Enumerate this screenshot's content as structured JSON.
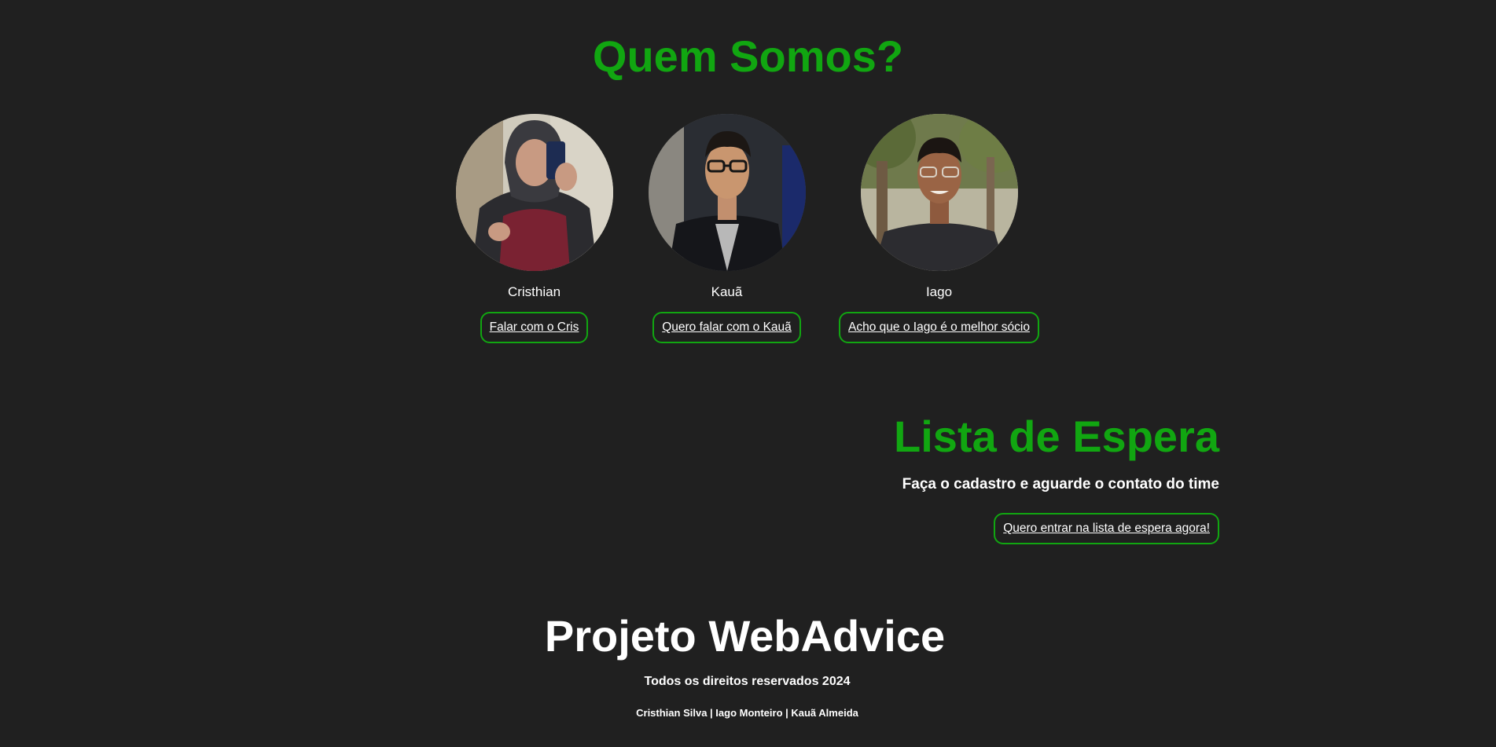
{
  "about": {
    "title": "Quem Somos?",
    "members": [
      {
        "name": "Cristhian",
        "link_label": "Falar com o Cris"
      },
      {
        "name": "Kauã",
        "link_label": "Quero falar com o Kauã"
      },
      {
        "name": "Iago",
        "link_label": "Acho que o Iago é o melhor sócio"
      }
    ]
  },
  "waitlist": {
    "title": "Lista de Espera",
    "subtitle": "Faça o cadastro e aguarde o contato do time",
    "link_label": "Quero entrar na lista de espera agora!"
  },
  "footer": {
    "title": "Projeto WebAdvice",
    "rights": "Todos os direitos reservados 2024",
    "credits": "Cristhian Silva | Iago Monteiro | Kauã Almeida"
  },
  "colors": {
    "background": "#202020",
    "accent": "#11a611",
    "text": "#ffffff"
  }
}
